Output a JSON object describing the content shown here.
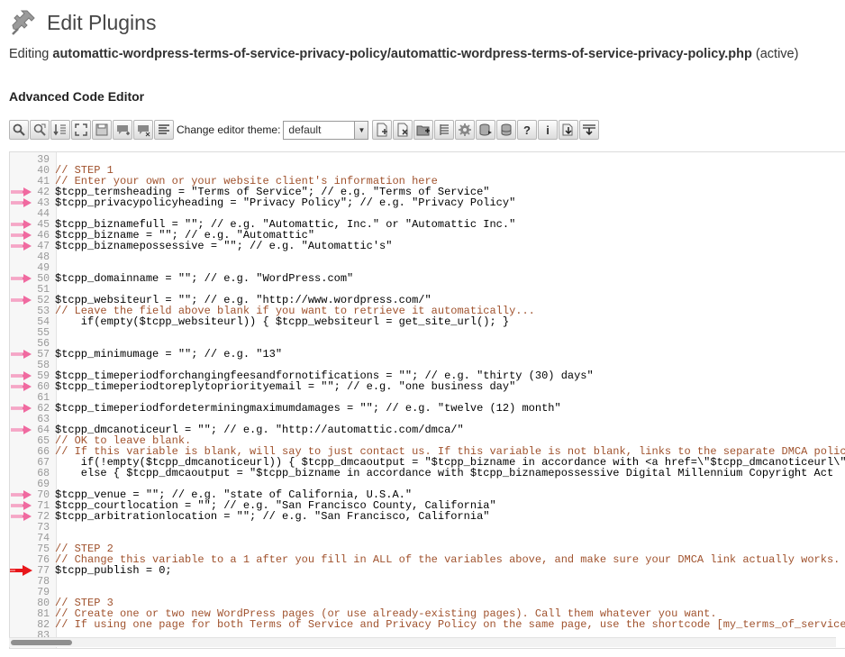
{
  "header": {
    "title": "Edit Plugins",
    "icon": "plug-icon"
  },
  "editing": {
    "prefix": "Editing ",
    "file": "automattic-wordpress-terms-of-service-privacy-policy/automattic-wordpress-terms-of-service-privacy-policy.php",
    "status": " (active)"
  },
  "section_title": "Advanced Code Editor",
  "toolbar": {
    "theme_label": "Change editor theme:",
    "theme_value": "default",
    "buttons_left": [
      "search-icon",
      "search-replace-icon",
      "jump-to-line-icon",
      "fullscreen-icon",
      "save-icon",
      "comment-icon",
      "uncomment-icon",
      "format-icon"
    ],
    "buttons_right": [
      "new-file-icon",
      "delete-file-icon",
      "new-folder-icon",
      "file-list-icon",
      "settings-icon",
      "export-database-icon",
      "database-icon",
      "help-icon",
      "info-icon",
      "download-icon",
      "download-all-icon"
    ]
  },
  "code_lines": [
    {
      "n": "39",
      "t": "",
      "c": "code",
      "a": ""
    },
    {
      "n": "40",
      "t": "// STEP 1",
      "c": "cmt",
      "a": ""
    },
    {
      "n": "41",
      "t": "// Enter your own or your website client's information here",
      "c": "cmt",
      "a": ""
    },
    {
      "n": "42",
      "t": "$tcpp_termsheading = \"Terms of Service\"; // e.g. \"Terms of Service\"",
      "c": "code",
      "a": "pink"
    },
    {
      "n": "43",
      "t": "$tcpp_privacypolicyheading = \"Privacy Policy\"; // e.g. \"Privacy Policy\"",
      "c": "code",
      "a": "pink"
    },
    {
      "n": "44",
      "t": "",
      "c": "code",
      "a": ""
    },
    {
      "n": "45",
      "t": "$tcpp_biznamefull = \"\"; // e.g. \"Automattic, Inc.\" or \"Automattic Inc.\"",
      "c": "code",
      "a": "pink"
    },
    {
      "n": "46",
      "t": "$tcpp_bizname = \"\"; // e.g. \"Automattic\"",
      "c": "code",
      "a": "pink"
    },
    {
      "n": "47",
      "t": "$tcpp_biznamepossessive = \"\"; // e.g. \"Automattic's\"",
      "c": "code",
      "a": "pink"
    },
    {
      "n": "48",
      "t": "",
      "c": "code",
      "a": ""
    },
    {
      "n": "49",
      "t": "",
      "c": "code",
      "a": ""
    },
    {
      "n": "50",
      "t": "$tcpp_domainname = \"\"; // e.g. \"WordPress.com\"",
      "c": "code",
      "a": "pink"
    },
    {
      "n": "51",
      "t": "",
      "c": "code",
      "a": ""
    },
    {
      "n": "52",
      "t": "$tcpp_websiteurl = \"\"; // e.g. \"http://www.wordpress.com/\"",
      "c": "code",
      "a": "pink"
    },
    {
      "n": "53",
      "t": "// Leave the field above blank if you want to retrieve it automatically...",
      "c": "cmt",
      "a": ""
    },
    {
      "n": "54",
      "t": "    if(empty($tcpp_websiteurl)) { $tcpp_websiteurl = get_site_url(); }",
      "c": "code",
      "a": ""
    },
    {
      "n": "55",
      "t": "",
      "c": "code",
      "a": ""
    },
    {
      "n": "56",
      "t": "",
      "c": "code",
      "a": ""
    },
    {
      "n": "57",
      "t": "$tcpp_minimumage = \"\"; // e.g. \"13\"",
      "c": "code",
      "a": "pink"
    },
    {
      "n": "58",
      "t": "",
      "c": "code",
      "a": ""
    },
    {
      "n": "59",
      "t": "$tcpp_timeperiodforchangingfeesandfornotifications = \"\"; // e.g. \"thirty (30) days\"",
      "c": "code",
      "a": "pink"
    },
    {
      "n": "60",
      "t": "$tcpp_timeperiodtoreplytopriorityemail = \"\"; // e.g. \"one business day\"",
      "c": "code",
      "a": "pink"
    },
    {
      "n": "61",
      "t": "",
      "c": "code",
      "a": ""
    },
    {
      "n": "62",
      "t": "$tcpp_timeperiodfordeterminingmaximumdamages = \"\"; // e.g. \"twelve (12) month\"",
      "c": "code",
      "a": "pink"
    },
    {
      "n": "63",
      "t": "",
      "c": "code",
      "a": ""
    },
    {
      "n": "64",
      "t": "$tcpp_dmcanoticeurl = \"\"; // e.g. \"http://automattic.com/dmca/\"",
      "c": "code",
      "a": "pink"
    },
    {
      "n": "65",
      "t": "// OK to leave blank.",
      "c": "cmt",
      "a": ""
    },
    {
      "n": "66",
      "t": "// If this variable is blank, will say to just contact us. If this variable is not blank, links to the separate DMCA policy",
      "c": "cmt",
      "a": ""
    },
    {
      "n": "67",
      "t": "    if(!empty($tcpp_dmcanoticeurl)) { $tcpp_dmcaoutput = \"$tcpp_bizname in accordance with <a href=\\\"$tcpp_dmcanoticeurl\\\">",
      "c": "code",
      "a": ""
    },
    {
      "n": "68",
      "t": "    else { $tcpp_dmcaoutput = \"$tcpp_bizname in accordance with $tcpp_biznamepossessive Digital Millennium Copyright Act",
      "c": "code",
      "a": ""
    },
    {
      "n": "69",
      "t": "",
      "c": "code",
      "a": ""
    },
    {
      "n": "70",
      "t": "$tcpp_venue = \"\"; // e.g. \"state of California, U.S.A.\"",
      "c": "code",
      "a": "pink"
    },
    {
      "n": "71",
      "t": "$tcpp_courtlocation = \"\"; // e.g. \"San Francisco County, California\"",
      "c": "code",
      "a": "pink"
    },
    {
      "n": "72",
      "t": "$tcpp_arbitrationlocation = \"\"; // e.g. \"San Francisco, California\"",
      "c": "code",
      "a": "pink"
    },
    {
      "n": "73",
      "t": "",
      "c": "code",
      "a": ""
    },
    {
      "n": "74",
      "t": "",
      "c": "code",
      "a": ""
    },
    {
      "n": "75",
      "t": "// STEP 2",
      "c": "cmt",
      "a": ""
    },
    {
      "n": "76",
      "t": "// Change this variable to a 1 after you fill in ALL of the variables above, and make sure your DMCA link actually works.",
      "c": "cmt",
      "a": ""
    },
    {
      "n": "77",
      "t": "$tcpp_publish = 0;",
      "c": "code",
      "a": "red"
    },
    {
      "n": "78",
      "t": "",
      "c": "code",
      "a": ""
    },
    {
      "n": "79",
      "t": "",
      "c": "code",
      "a": ""
    },
    {
      "n": "80",
      "t": "// STEP 3",
      "c": "cmt",
      "a": ""
    },
    {
      "n": "81",
      "t": "// Create one or two new WordPress pages (or use already-existing pages). Call them whatever you want.",
      "c": "cmt",
      "a": ""
    },
    {
      "n": "82",
      "t": "// If using one page for both Terms of Service and Privacy Policy on the same page, use the shortcode [my_terms_of_service",
      "c": "cmt",
      "a": ""
    },
    {
      "n": "83",
      "t": "",
      "c": "code",
      "a": ""
    }
  ],
  "colors": {
    "pink_arrow": "#f06aa0",
    "red_arrow": "#e8171b",
    "comment": "#a0522d"
  }
}
